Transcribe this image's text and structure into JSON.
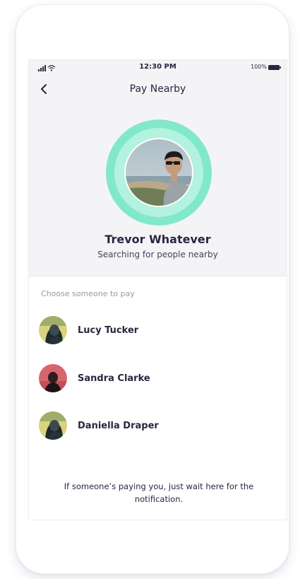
{
  "status_bar": {
    "time": "12:30 PM",
    "battery": "100%"
  },
  "nav": {
    "title": "Pay Nearby",
    "back_icon": "chevron-left-icon"
  },
  "profile": {
    "name": "Trevor Whatever",
    "status": "Searching for people nearby"
  },
  "list": {
    "label": "Choose someone to pay",
    "people": [
      {
        "name": "Lucy Tucker"
      },
      {
        "name": "Sandra Clarke"
      },
      {
        "name": "Daniella Draper"
      }
    ]
  },
  "footer": {
    "message": "If someone’s paying you, just wait here for the notification."
  },
  "colors": {
    "accent_ring_outer": "#82e8ca",
    "accent_ring_inner": "#b2f2de",
    "text_primary": "#2d2440",
    "header_background": "#f4f4f6"
  }
}
